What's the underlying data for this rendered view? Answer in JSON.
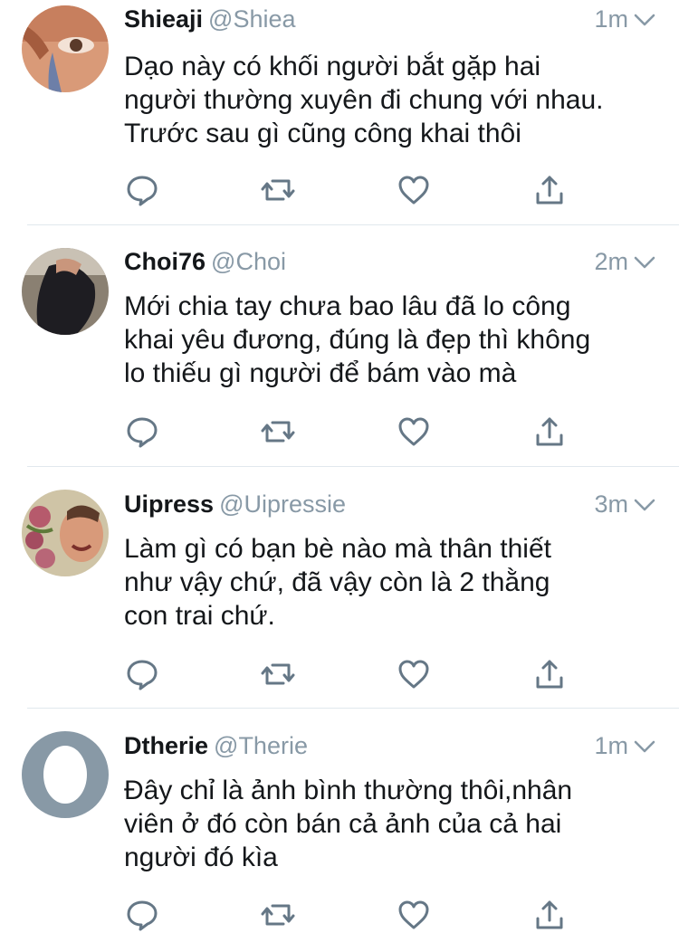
{
  "theme": {
    "text_color": "#14171a",
    "secondary_color": "#8899a6",
    "icon_color": "#657786",
    "divider_color": "#e1e8ed"
  },
  "tweets": [
    {
      "name": "Shieaji",
      "handle": "@Shiea",
      "time": "1m",
      "lines": [
        "Dạo này có khối người bắt gặp hai",
        "người thường xuyên đi chung với nhau.",
        "Trước sau gì cũng công khai thôi"
      ]
    },
    {
      "name": "Choi76",
      "handle": "@Choi",
      "time": "2m",
      "lines": [
        "Mới chia tay chưa bao lâu đã lo công",
        "khai yêu đương, đúng là đẹp thì không",
        "lo thiếu gì người để bám vào mà"
      ]
    },
    {
      "name": "Uipress",
      "handle": "@Uipressie",
      "time": "3m",
      "lines": [
        "Làm gì có bạn bè nào mà thân thiết",
        "như vậy chứ, đã vậy còn là 2 thằng",
        "con trai chứ."
      ]
    },
    {
      "name": "Dtherie",
      "handle": "@Therie",
      "time": "1m",
      "lines": [
        "Đây chỉ là ảnh bình thường thôi,nhân",
        "viên ở đó còn bán cả ảnh của cả hai",
        "người đó kìa"
      ]
    }
  ],
  "icons": {
    "reply": "reply-icon",
    "retweet": "retweet-icon",
    "like": "heart-icon",
    "share": "share-icon",
    "menu": "chevron-down-icon"
  }
}
